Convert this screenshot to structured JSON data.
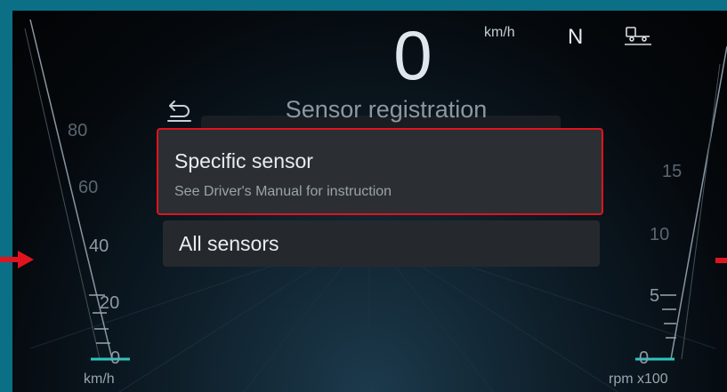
{
  "speedometer": {
    "speed": "0",
    "unit": "km/h",
    "ticks": [
      "80",
      "60",
      "40",
      "20",
      "0"
    ],
    "scale_unit": "km/h"
  },
  "tachometer": {
    "ticks": [
      "15",
      "10",
      "5",
      "0"
    ],
    "scale_unit": "rpm x100"
  },
  "status": {
    "gear": "N",
    "trailer_icon": "trailer-icon"
  },
  "menu": {
    "title": "Sensor registration",
    "back_icon": "back-arrow-icon",
    "items": [
      {
        "label": "Specific sensor",
        "sublabel": "See Driver's Manual for instruction",
        "selected": true
      },
      {
        "label": "All sensors",
        "selected": false
      }
    ]
  },
  "colors": {
    "highlight_border": "#e0141e",
    "gauge_needle": "#2ec4c0",
    "frame_accent": "#0b6f86"
  }
}
